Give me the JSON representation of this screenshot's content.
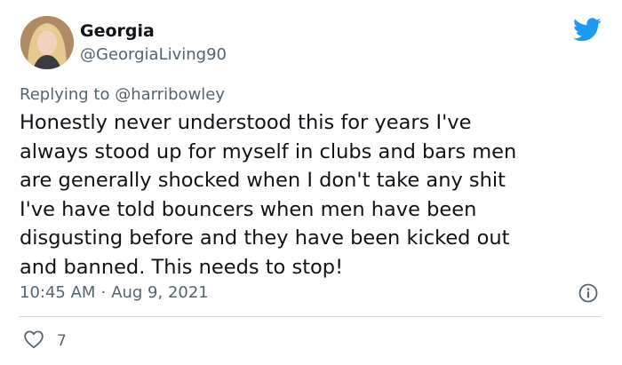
{
  "tweet": {
    "display_name": "Georgia",
    "handle": "@GeorgiaLiving90",
    "replying_prefix": "Replying to ",
    "replying_to": "@harribowley",
    "text": "Honestly never understood this for years I've\nalways stood up for myself in clubs and bars men\nare generally shocked when I don't take any shit\nI've have told bouncers when men have been\ndisgusting before and they have been kicked out\nand banned. This needs to stop!",
    "time": "10:45 AM",
    "separator": "·",
    "date": "Aug 9, 2021",
    "likes": "7"
  },
  "icons": {
    "brand": "twitter-bird-icon",
    "info": "info-icon",
    "like": "heart-icon"
  },
  "colors": {
    "brand": "#1d9bf0",
    "text": "#0f1419",
    "muted": "#536471",
    "divider": "#cfd9de"
  }
}
